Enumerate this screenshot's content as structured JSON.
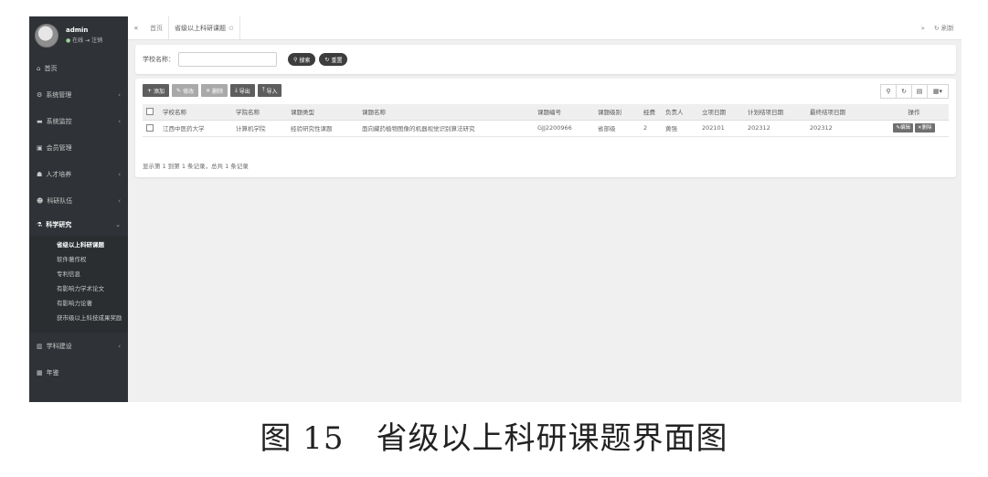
{
  "user": {
    "name": "admin",
    "status_online": "在线",
    "status_logout": "注销"
  },
  "sidebar": {
    "items": [
      {
        "label": "首页",
        "icon": "home-icon",
        "glyph": "⌂",
        "chev": ""
      },
      {
        "label": "系统管理",
        "icon": "gear-icon",
        "glyph": "⚙",
        "chev": "‹"
      },
      {
        "label": "系统监控",
        "icon": "monitor-icon",
        "glyph": "▬",
        "chev": "‹"
      },
      {
        "label": "会员管理",
        "icon": "card-icon",
        "glyph": "▣",
        "chev": ""
      },
      {
        "label": "人才培养",
        "icon": "grad-cap-icon",
        "glyph": "☗",
        "chev": "‹"
      },
      {
        "label": "科研队伍",
        "icon": "users-icon",
        "glyph": "☻",
        "chev": "‹"
      }
    ],
    "active_group": {
      "label": "科学研究",
      "chev": "⌄"
    },
    "sub_items": [
      {
        "label": "省级以上科研课题",
        "active": true
      },
      {
        "label": "软件著作权"
      },
      {
        "label": "专利信息"
      },
      {
        "label": "有影响力学术论文"
      },
      {
        "label": "有影响力论著"
      },
      {
        "label": "获市级以上科技成果奖励"
      }
    ],
    "items_after": [
      {
        "label": "学科建设",
        "icon": "book-icon",
        "glyph": "▥",
        "chev": "‹"
      },
      {
        "label": "年鉴",
        "icon": "calendar-icon",
        "glyph": "▦",
        "chev": ""
      }
    ]
  },
  "tabbar": {
    "prev": "«",
    "home_tab": "首页",
    "active_tab": "省级以上科研课题",
    "next": "»",
    "refresh": "刷新"
  },
  "search": {
    "school_label": "学校名称：",
    "school_value": "",
    "search_btn": "搜索",
    "reset_btn": "重置"
  },
  "toolbar": {
    "add": "添加",
    "edit": "修改",
    "delete": "删除",
    "export": "导出",
    "import": "导入"
  },
  "table": {
    "headers": [
      "学校名称",
      "学院名称",
      "课题类型",
      "课题名称",
      "课题编号",
      "课题级别",
      "经费",
      "负责人",
      "立项日期",
      "计划结项日期",
      "最终结项日期",
      "操作"
    ],
    "rows": [
      [
        "江西中医药大学",
        "计算机学院",
        "经验研究性课题",
        "面向藏药植物图像的机器视觉识别算法研究",
        "GJJ2200966",
        "省部级",
        "2",
        "黄强",
        "202101",
        "202312",
        "202312"
      ]
    ],
    "row_edit": "编辑",
    "row_delete": "删除"
  },
  "pagination_info": "显示第 1 到第 1 条记录，总共 1 条记录",
  "caption": "图 15　省级以上科研课题界面图"
}
